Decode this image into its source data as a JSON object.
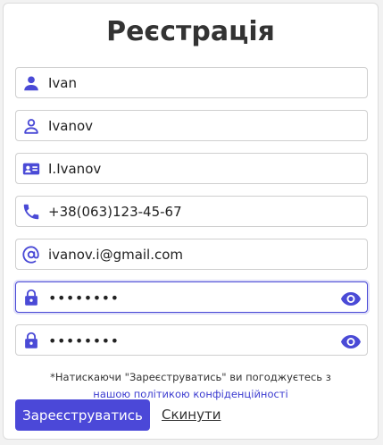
{
  "form": {
    "title": "Реєстрація",
    "fields": [
      {
        "icon": "person-icon",
        "value": "Ivan"
      },
      {
        "icon": "person-outline-icon",
        "value": "Ivanov"
      },
      {
        "icon": "badge-icon",
        "value": "I.Ivanov"
      },
      {
        "icon": "phone-icon",
        "value": "+38(063)123-45-67"
      },
      {
        "icon": "at-icon",
        "value": "ivanov.i@gmail.com"
      },
      {
        "icon": "lock-icon",
        "value": "••••••••",
        "toggle_icon": "eye-icon"
      },
      {
        "icon": "lock-icon",
        "value": "••••••••",
        "toggle_icon": "eye-icon"
      }
    ],
    "notice_text": "*Натискаючи \"Зареєструватись\" ви погоджуєтесь з",
    "notice_link": "нашою політикою конфіденційності",
    "submit_label": "Зареєструватись",
    "reset_label": "Скинути"
  },
  "colors": {
    "accent": "#4b48d8",
    "icon": "#4a4ad6",
    "background": "#ffffff"
  }
}
